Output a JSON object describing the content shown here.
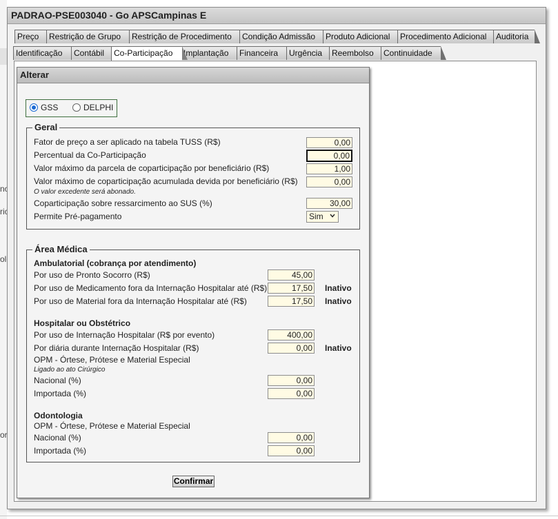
{
  "window": {
    "title": "PADRAO-PSE003040 - Go APSCampinas E"
  },
  "background": {
    "left_fragments": [
      "no",
      "ric",
      "olo",
      "or"
    ]
  },
  "tabs": {
    "row1": [
      "Preço",
      "Restrição de Grupo",
      "Restrição de Procedimento",
      "Condição Admissão",
      "Produto Adicional",
      "Procedimento Adicional",
      "Auditoria"
    ],
    "row2": [
      "Identificação",
      "Contábil",
      "Co-Participação",
      "Implantação",
      "Financeira",
      "Urgência",
      "Reembolso",
      "Continuidade"
    ],
    "active": "Co-Participação"
  },
  "form": {
    "title": "Alterar",
    "source_options": [
      {
        "label": "GSS",
        "selected": true
      },
      {
        "label": "DELPHI",
        "selected": false
      }
    ],
    "geral": {
      "legend": "Geral",
      "rows": [
        {
          "label": "Fator de preço a ser aplicado na tabela TUSS (R$)",
          "value": "0,00"
        },
        {
          "label": "Percentual da Co-Participação",
          "value": "0,00"
        },
        {
          "label": "Valor máximo da parcela de coparticipação por beneficiário (R$)",
          "value": "1,00"
        },
        {
          "label": "Valor máximo de coparticipação acumulada devida por beneficiário (R$)",
          "value": "0,00"
        },
        {
          "label": "Coparticipação sobre ressarcimento ao SUS (%)",
          "value": "30,00"
        }
      ],
      "note": "O valor excedente será abonado.",
      "prepay_label": "Permite Pré-pagamento",
      "prepay_value": "Sim"
    },
    "area_medica": {
      "legend": "Área Médica",
      "ambulatorial": {
        "title": "Ambulatorial (cobrança por atendimento)",
        "rows": [
          {
            "label": "Por uso de Pronto Socorro (R$)",
            "value": "45,00",
            "status": ""
          },
          {
            "label": "Por uso de Medicamento fora da Internação Hospitalar até (R$)",
            "value": "17,50",
            "status": "Inativo"
          },
          {
            "label": "Por uso de Material fora da Internação Hospitalar até (R$)",
            "value": "17,50",
            "status": "Inativo"
          }
        ]
      },
      "hospitalar": {
        "title": "Hospitalar ou Obstétrico",
        "rows": [
          {
            "label": "Por uso de Internação Hospitalar (R$ por evento)",
            "value": "400,00",
            "status": ""
          },
          {
            "label": "Por diária durante Internação Hospitalar (R$)",
            "value": "0,00",
            "status": "Inativo"
          }
        ],
        "opm_label": "OPM - Órtese, Prótese e Material Especial",
        "opm_note": "Ligado ao ato Cirúrgico",
        "opm_rows": [
          {
            "label": "Nacional (%)",
            "value": "0,00"
          },
          {
            "label": "Importada (%)",
            "value": "0,00"
          }
        ]
      },
      "odontologia": {
        "title": "Odontologia",
        "opm_label": "OPM - Órtese, Prótese e Material Especial",
        "opm_rows": [
          {
            "label": "Nacional (%)",
            "value": "0,00"
          },
          {
            "label": "Importada (%)",
            "value": "0,00"
          }
        ]
      }
    },
    "confirm_label": "Confirmar"
  }
}
